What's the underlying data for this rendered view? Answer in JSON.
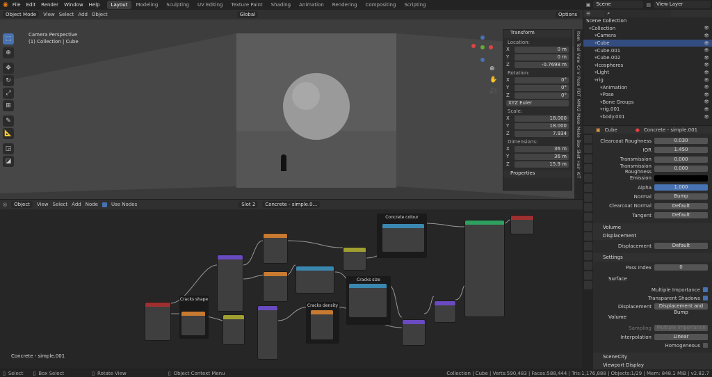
{
  "menu": [
    "File",
    "Edit",
    "Render",
    "Window",
    "Help"
  ],
  "workspace_tabs": [
    "Layout",
    "Modeling",
    "Sculpting",
    "UV Editing",
    "Texture Paint",
    "Shading",
    "Animation",
    "Rendering",
    "Compositing",
    "Scripting"
  ],
  "scene": "Scene",
  "view_layer": "View Layer",
  "viewport": {
    "mode": "Object Mode",
    "menus": [
      "View",
      "Select",
      "Add",
      "Object"
    ],
    "orientation": "Global",
    "options": "Options",
    "overlay_title": "Camera Perspective",
    "overlay_sub": "(1) Collection | Cube"
  },
  "npanel": {
    "title": "Transform",
    "location_label": "Location:",
    "loc": [
      {
        "axis": "X",
        "val": "0 m"
      },
      {
        "axis": "Y",
        "val": "0 m"
      },
      {
        "axis": "Z",
        "val": "-0.7698 m"
      }
    ],
    "rotation_label": "Rotation:",
    "rot": [
      {
        "axis": "X",
        "val": "0°"
      },
      {
        "axis": "Y",
        "val": "0°"
      },
      {
        "axis": "Z",
        "val": "0°"
      }
    ],
    "euler": "XYZ Euler",
    "scale_label": "Scale:",
    "scale": [
      {
        "axis": "X",
        "val": "18.000"
      },
      {
        "axis": "Y",
        "val": "18.000"
      },
      {
        "axis": "Z",
        "val": "7.934"
      }
    ],
    "dims_label": "Dimensions:",
    "dims": [
      {
        "axis": "X",
        "val": "36 m"
      },
      {
        "axis": "Y",
        "val": "36 m"
      },
      {
        "axis": "Z",
        "val": "15.9 m"
      }
    ],
    "properties": "Properties"
  },
  "sidetabs": [
    "Item",
    "Tool",
    "View",
    "Cr",
    "V",
    "Pose",
    "PDT",
    "MMV2",
    "Make",
    "Make",
    "Box",
    "Sket",
    "Hair",
    "KIT"
  ],
  "nodeeditor": {
    "type": "Object",
    "menus": [
      "View",
      "Select",
      "Add",
      "Node"
    ],
    "use_nodes": "Use Nodes",
    "slot": "Slot 2",
    "material": "Concrete - simple.0...",
    "footer": "Concrete - simple.001",
    "frames": [
      "Cracks shape",
      "Cracks density",
      "Cracks size",
      "Concrete colour"
    ]
  },
  "outliner": {
    "title": "Scene Collection",
    "rows": [
      "Collection",
      "Camera",
      "Cube",
      "Cube.001",
      "Cube.002",
      "Icospheres",
      "Light",
      "rig",
      "Animation",
      "Pose",
      "Bone Groups",
      "rig.001",
      "body.001"
    ]
  },
  "props": {
    "obj": "Cube",
    "mat": "Concrete - simple.001",
    "rows": [
      {
        "l": "Clearcoat Roughness",
        "v": "0.030"
      },
      {
        "l": "IOR",
        "v": "1.450"
      },
      {
        "l": "Transmission",
        "v": "0.000"
      },
      {
        "l": "Transmission Roughness",
        "v": "0.000"
      },
      {
        "l": "Emission",
        "v": ""
      },
      {
        "l": "Alpha",
        "v": "1.000"
      },
      {
        "l": "Normal",
        "v": "Bump"
      },
      {
        "l": "Clearcoat Normal",
        "v": "Default"
      },
      {
        "l": "Tangent",
        "v": "Default"
      }
    ],
    "volume": "Volume",
    "displacement_head": "Displacement",
    "displacement_label": "Displacement",
    "displacement_val": "Default",
    "settings": "Settings",
    "pass_index_label": "Pass Index",
    "pass_index": "0",
    "surface": "Surface",
    "multi_imp": "Multiple Importance",
    "trans_shadows": "Transparent Shadows",
    "disp2_label": "Displacement",
    "disp2_val": "Displacement and Bump",
    "volume2": "Volume",
    "sampling_label": "Sampling",
    "sampling_val": "Multiple Importance",
    "interp_label": "Interpolation",
    "interp_val": "Linear",
    "homogeneous": "Homogeneous",
    "scenecity": "SceneCity",
    "viewport_display": "Viewport Display"
  },
  "status": {
    "select": "Select",
    "box_select": "Box Select",
    "rotate_view": "Rotate View",
    "context_menu": "Object Context Menu",
    "stats": "Collection | Cube | Verts:590,483 | Faces:588,444 | Tris:1,176,888 | Objects:1/29 | Mem: 848.1 MiB | v2.82.7"
  },
  "colors": {
    "accent": "#4772b3",
    "selected_row": "#334d80",
    "alpha_bar": "#4772b3"
  }
}
